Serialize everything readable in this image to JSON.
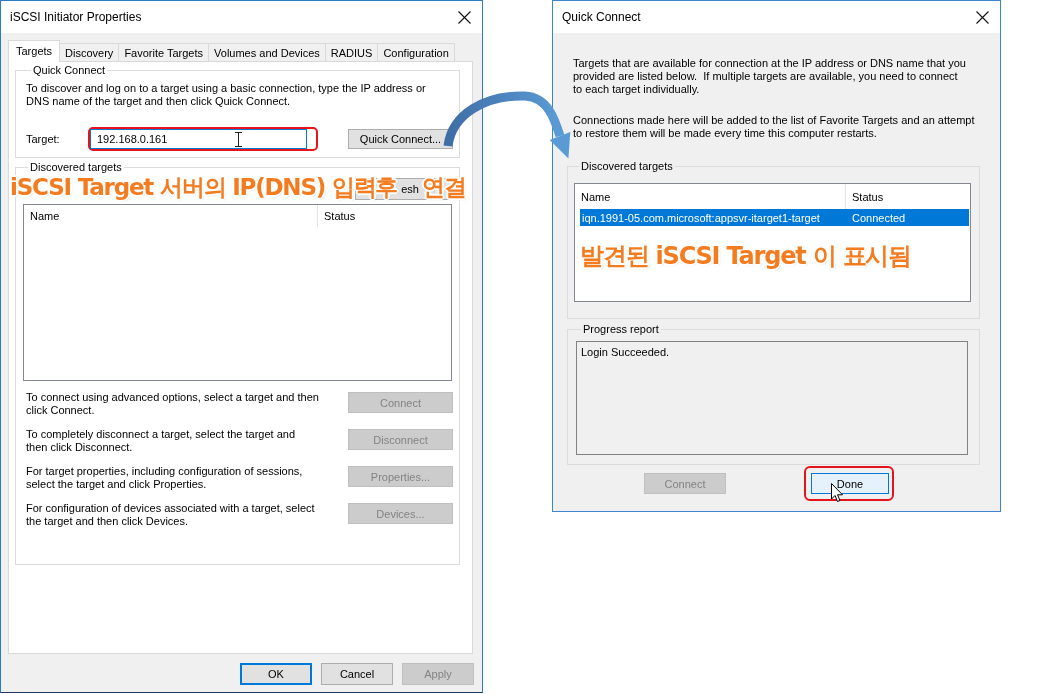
{
  "initiator_window": {
    "title": "iSCSI Initiator Properties",
    "tabs": [
      {
        "label": "Targets",
        "selected": true
      },
      {
        "label": "Discovery",
        "selected": false
      },
      {
        "label": "Favorite Targets",
        "selected": false
      },
      {
        "label": "Volumes and Devices",
        "selected": false
      },
      {
        "label": "RADIUS",
        "selected": false
      },
      {
        "label": "Configuration",
        "selected": false
      }
    ],
    "quick_connect": {
      "heading": "Quick Connect",
      "description": "To discover and log on to a target using a basic connection, type the IP address or\nDNS name of the target and then click Quick Connect.",
      "target_label": "Target:",
      "target_value": "192.168.0.161",
      "highlighted": true,
      "button": "Quick Connect..."
    },
    "discovered_targets": {
      "heading": "Discovered targets",
      "refresh_button": "esh",
      "columns": [
        "Name",
        "Status"
      ],
      "actions": [
        {
          "description": "To connect using advanced options, select a target and then\nclick Connect.",
          "button": "Connect",
          "disabled": true
        },
        {
          "description": "To completely disconnect a target, select the target and\nthen click Disconnect.",
          "button": "Disconnect",
          "disabled": true
        },
        {
          "description": "For target properties, including configuration of sessions,\nselect the target and click Properties.",
          "button": "Properties...",
          "disabled": true
        },
        {
          "description": "For configuration of devices associated with a target, select\nthe target and then click Devices.",
          "button": "Devices...",
          "disabled": true
        }
      ]
    },
    "buttons": [
      {
        "label": "OK",
        "default": true,
        "disabled": false
      },
      {
        "label": "Cancel",
        "default": false,
        "disabled": false
      },
      {
        "label": "Apply",
        "default": false,
        "disabled": true
      }
    ]
  },
  "quick_connect_window": {
    "title": "Quick Connect",
    "paragraphs": [
      "Targets that are available for connection at the IP address or DNS name that you\nprovided are listed below.  If multiple targets are available, you need to connect\nto each target individually.",
      "Connections made here will be added to the list of Favorite Targets and an attempt\nto restore them will be made every time this computer restarts."
    ],
    "discovered_targets": {
      "heading": "Discovered targets",
      "columns": [
        "Name",
        "Status"
      ],
      "rows": [
        {
          "name": "iqn.1991-05.com.microsoft:appsvr-itarget1-target",
          "status": "Connected",
          "selected": true
        }
      ]
    },
    "progress_report": {
      "heading": "Progress report",
      "text": "Login Succeeded."
    },
    "buttons": [
      {
        "label": "Connect",
        "disabled": true,
        "default": false,
        "hovered": false,
        "highlighted": false
      },
      {
        "label": "Done",
        "disabled": false,
        "default": true,
        "hovered": true,
        "highlighted": true
      }
    ]
  },
  "annotations": [
    {
      "text": "iSCSI Target 서버의 IP(DNS) 입력후"
    },
    {
      "text": "연결"
    },
    {
      "text": "발견된 iSCSI Target 이 표시됨"
    }
  ]
}
